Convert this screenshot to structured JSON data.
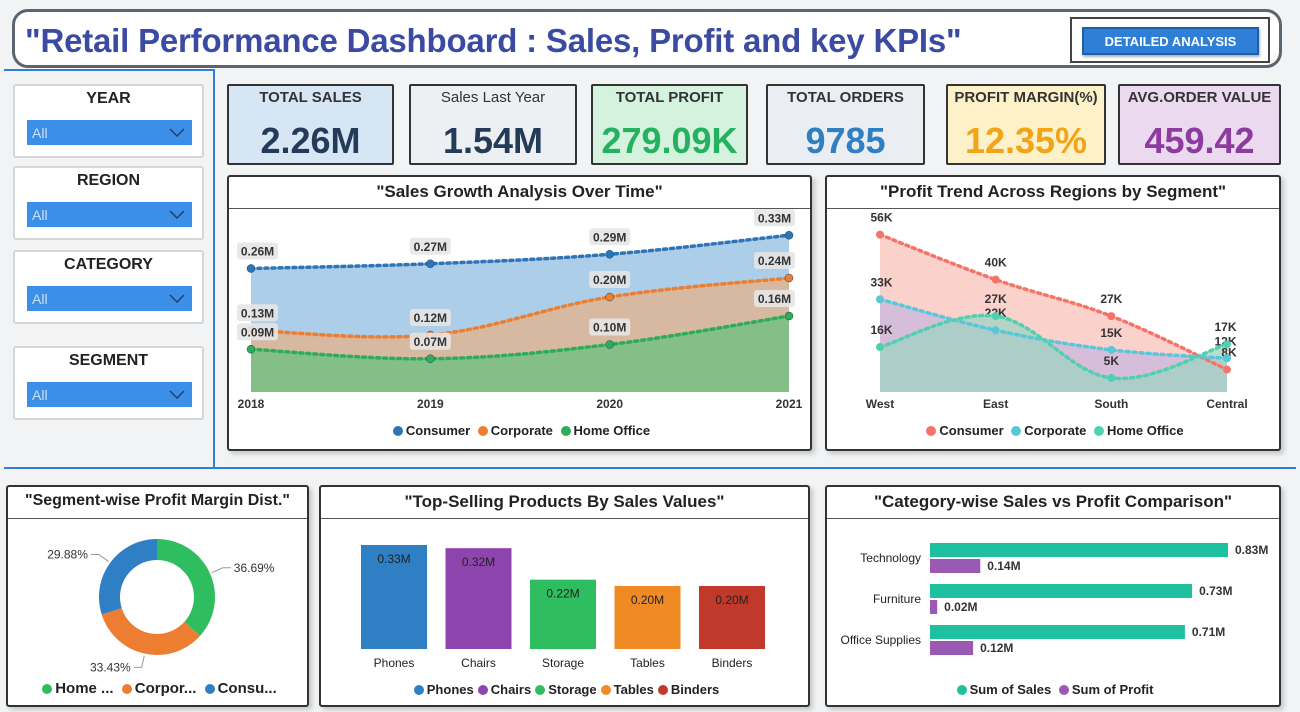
{
  "header": {
    "title": "\"Retail Performance Dashboard : Sales, Profit and key KPIs\"",
    "detail_button": "DETAILED ANALYSIS"
  },
  "slicers": [
    {
      "label": "YEAR",
      "value": "All"
    },
    {
      "label": "REGION",
      "value": "All"
    },
    {
      "label": "CATEGORY",
      "value": "All"
    },
    {
      "label": "SEGMENT",
      "value": "All"
    }
  ],
  "kpis": [
    {
      "label": "TOTAL SALES",
      "value": "2.26M",
      "bg": "#d7e6f5",
      "color": "#233b58"
    },
    {
      "label": "Sales Last Year",
      "value": "1.54M",
      "bg": "#edf0f2",
      "color": "#233b58"
    },
    {
      "label": "TOTAL PROFIT",
      "value": "279.09K",
      "bg": "#d5f2df",
      "color": "#23b25f"
    },
    {
      "label": "TOTAL ORDERS",
      "value": "9785",
      "bg": "#eaedf2",
      "color": "#2e7fc4"
    },
    {
      "label": "PROFIT MARGIN(%)",
      "value": "12.35%",
      "bg": "#fdf1c9",
      "color": "#f2a417"
    },
    {
      "label": "AVG.ORDER VALUE",
      "value": "459.42",
      "bg": "#ead9ef",
      "color": "#8b3c9e"
    }
  ],
  "chart_data": [
    {
      "type": "area",
      "title": "\"Sales Growth Analysis Over Time\"",
      "x": [
        "2018",
        "2019",
        "2020",
        "2021"
      ],
      "series": [
        {
          "name": "Consumer",
          "values": [
            0.26,
            0.27,
            0.29,
            0.33
          ],
          "labels": [
            "0.26M",
            "0.27M",
            "0.29M",
            "0.33M"
          ],
          "color": "#2e75b6"
        },
        {
          "name": "Corporate",
          "values": [
            0.13,
            0.12,
            0.2,
            0.24
          ],
          "labels": [
            "0.13M",
            "0.12M",
            "0.20M",
            "0.24M"
          ],
          "color": "#ed7d31"
        },
        {
          "name": "Home Office",
          "values": [
            0.09,
            0.07,
            0.1,
            0.16
          ],
          "labels": [
            "0.09M",
            "0.07M",
            "0.10M",
            "0.16M"
          ],
          "color": "#2ead58"
        }
      ]
    },
    {
      "type": "area",
      "title": "\"Profit Trend Across Regions by Segment\"",
      "x": [
        "West",
        "East",
        "South",
        "Central"
      ],
      "series": [
        {
          "name": "Consumer",
          "values": [
            56,
            40,
            27,
            8
          ],
          "labels": [
            "56K",
            "40K",
            "27K",
            "8K"
          ],
          "color": "#f47468"
        },
        {
          "name": "Corporate",
          "values": [
            33,
            22,
            15,
            12
          ],
          "labels": [
            "33K",
            "22K",
            "15K",
            "12K"
          ],
          "color": "#58c7d9"
        },
        {
          "name": "Home Office",
          "values": [
            16,
            27,
            5,
            17
          ],
          "labels": [
            "16K",
            "27K",
            "5K",
            "17K"
          ],
          "color": "#4fd0b0"
        }
      ]
    },
    {
      "type": "pie",
      "title": "\"Segment-wise Profit Margin Dist.\"",
      "series": [
        {
          "name": "Home ...",
          "value": 36.69,
          "label": "36.69%",
          "color": "#2ebd5f"
        },
        {
          "name": "Corpor...",
          "value": 33.43,
          "label": "33.43%",
          "color": "#ed7d31"
        },
        {
          "name": "Consu...",
          "value": 29.88,
          "label": "29.88%",
          "color": "#2e7fc4"
        }
      ]
    },
    {
      "type": "bar",
      "title": "\"Top-Selling Products By Sales Values\"",
      "categories": [
        "Phones",
        "Chairs",
        "Storage",
        "Tables",
        "Binders"
      ],
      "values": [
        0.33,
        0.32,
        0.22,
        0.2,
        0.2
      ],
      "labels": [
        "0.33M",
        "0.32M",
        "0.22M",
        "0.20M",
        "0.20M"
      ],
      "colors": [
        "#2e7fc4",
        "#8e44ad",
        "#2ebd5f",
        "#f08a24",
        "#c0392b"
      ]
    },
    {
      "type": "bar",
      "orientation": "horizontal",
      "title": "\"Category-wise Sales vs Profit Comparison\"",
      "categories": [
        "Technology",
        "Furniture",
        "Office Supplies"
      ],
      "series": [
        {
          "name": "Sum of Sales",
          "values": [
            0.83,
            0.73,
            0.71
          ],
          "labels": [
            "0.83M",
            "0.73M",
            "0.71M"
          ],
          "color": "#1fc0a0"
        },
        {
          "name": "Sum of Profit",
          "values": [
            0.14,
            0.02,
            0.12
          ],
          "labels": [
            "0.14M",
            "0.02M",
            "0.12M"
          ],
          "color": "#9b59b6"
        }
      ]
    }
  ]
}
